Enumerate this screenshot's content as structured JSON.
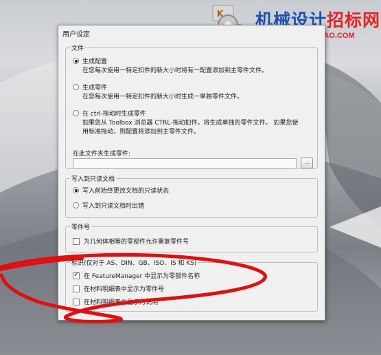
{
  "watermark": {
    "title_blue": "机械设计",
    "title_red": "招标网",
    "url": "www.JIXIEZHAOBIAO.COM"
  },
  "dialog": {
    "title": "用户设定",
    "file_group": {
      "caption": "文件",
      "options": [
        {
          "label": "生成配置",
          "selected": true,
          "desc": [
            "在您每次使用一特定扣件的新大小时将有一配置添加到主零件文件。"
          ]
        },
        {
          "label": "生成零件",
          "selected": false,
          "desc": [
            "在您每次使用一特定扣件的新大小时生成一单独零件文件。"
          ]
        },
        {
          "label": "在 ctrl-拖动时生成零件",
          "selected": false,
          "desc": [
            "如果您从 Toolbox 浏览器 CTRL-拖动扣件，将生成单独的零件文件。 如果您使",
            "用标准拖动，则配置将添加到主零件文件。"
          ]
        }
      ],
      "folder_label": "在此文件夹生成零件:",
      "folder_value": "",
      "browse_label": "..."
    },
    "readonly_group": {
      "caption": "写入到只读文档",
      "options": [
        {
          "label": "写入前始终更改文档的只读状态",
          "selected": true
        },
        {
          "label": "写入到只读文档时出错",
          "selected": false
        }
      ]
    },
    "partnum_group": {
      "caption": "零件号",
      "options": [
        {
          "label": "为几何体相等的零部件允许重复零件号",
          "checked": false
        }
      ]
    },
    "marking_group": {
      "caption": "标识(仅对于 AS、DIN、GB、ISO、IS 和 KS)",
      "options": [
        {
          "label": "在 FeatureManager 中显示为零部件名称",
          "checked": true
        },
        {
          "label": "在材料明细表中显示为零件号",
          "checked": false
        },
        {
          "label": "在材料明细表中显示为说明",
          "checked": false
        }
      ]
    }
  },
  "colors": {
    "annotation": "#e01010",
    "dialog_bg": "#f0f0f0",
    "watermark_blue": "#1b4fb0",
    "watermark_red": "#e32424"
  }
}
